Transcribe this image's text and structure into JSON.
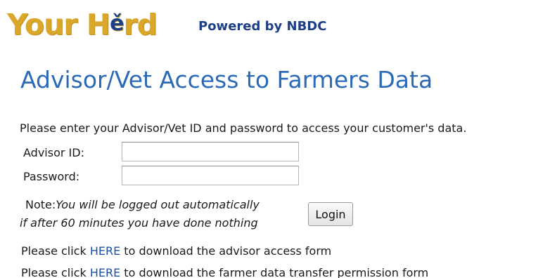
{
  "header": {
    "logo": {
      "part1": "Your H",
      "e_mark": "ě",
      "part2": "rd"
    },
    "powered_by": "Powered by NBDC"
  },
  "main": {
    "title": "Advisor/Vet Access to Farmers Data",
    "intro": "Please enter your Advisor/Vet ID and password to access your customer's data.",
    "form": {
      "advisor_id_label": "Advisor ID:",
      "advisor_id_value": "",
      "password_label": "Password:",
      "password_value": "",
      "note_label": "Note:",
      "note_line1": "You will be logged out automatically",
      "note_line2": "if after 60 minutes you have done nothing",
      "login_label": "Login"
    },
    "links": [
      {
        "prefix": "Please click ",
        "link_text": "HERE",
        "suffix": " to download the advisor access form"
      },
      {
        "prefix": "Please click ",
        "link_text": "HERE",
        "suffix": " to download the farmer data transfer permission form"
      }
    ]
  },
  "colors": {
    "logo_gold": "#dba72b",
    "brand_blue": "#1d3f88",
    "title_blue": "#2a6ab7",
    "link_blue": "#1f4fa8"
  }
}
